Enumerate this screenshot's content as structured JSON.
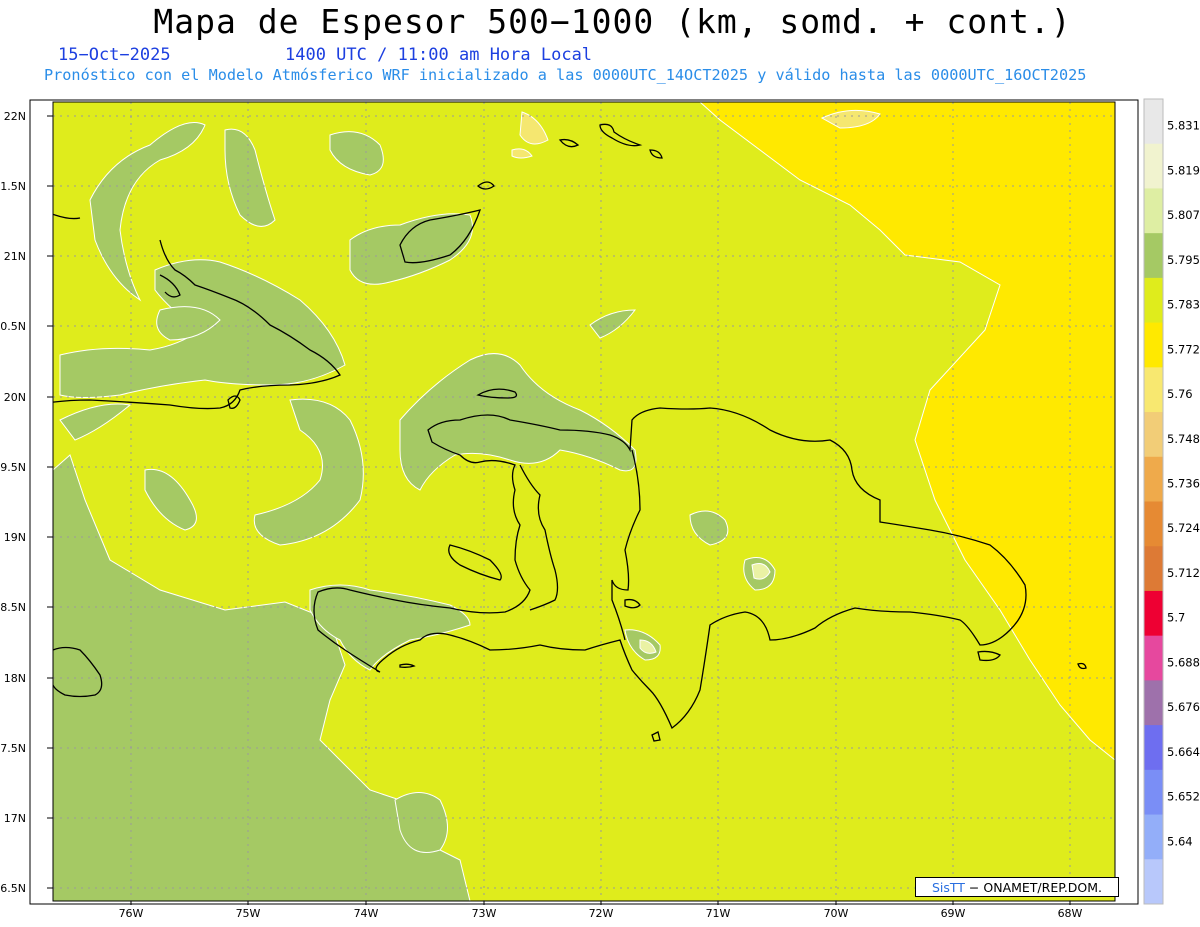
{
  "title": "Mapa de Espesor 500−1000 (km, somd. + cont.)",
  "date": "15−Oct−2025",
  "time_info": "1400 UTC / 11:00 am Hora Local",
  "forecast_info": "Pronóstico con el Modelo Atmósferico WRF inicializado a las 0000UTC_14OCT2025 y válido hasta las  0000UTC_16OCT2025",
  "credit": {
    "brand": "SisTT",
    "rest": " − ONAMET/REP.DOM."
  },
  "map": {
    "x_ticks": [
      "76W",
      "75W",
      "74W",
      "73W",
      "72W",
      "71W",
      "70W",
      "69W",
      "68W"
    ],
    "y_ticks": [
      "22N",
      "1.5N",
      "21N",
      "0.5N",
      "20N",
      "9.5N",
      "19N",
      "8.5N",
      "18N",
      "7.5N",
      "17N",
      "6.5N"
    ],
    "colors": {
      "field_main": "#dfec1c",
      "field_green": "#a5c964",
      "field_yellow": "#ffe900",
      "field_pale_yellow": "#f5e770",
      "field_light": "#eaf2a4",
      "grid": "#9a9a9a",
      "coast": "#000000"
    }
  },
  "colorbar": {
    "labels": [
      "5.831",
      "5.819",
      "5.807",
      "5.795",
      "5.783",
      "5.772",
      "5.76",
      "5.748",
      "5.736",
      "5.724",
      "5.712",
      "5.7",
      "5.688",
      "5.676",
      "5.664",
      "5.652",
      "5.64"
    ],
    "colors": [
      "#e8e8e8",
      "#f1f3cf",
      "#deeea3",
      "#a5c964",
      "#dfec1c",
      "#ffe900",
      "#f8e870",
      "#f2cd77",
      "#efaa4b",
      "#e68a33",
      "#dd7a35",
      "#ee0033",
      "#e6489e",
      "#9e71ab",
      "#6e6ef0",
      "#7a8ef6",
      "#93aef9",
      "#b8c8fb"
    ]
  }
}
